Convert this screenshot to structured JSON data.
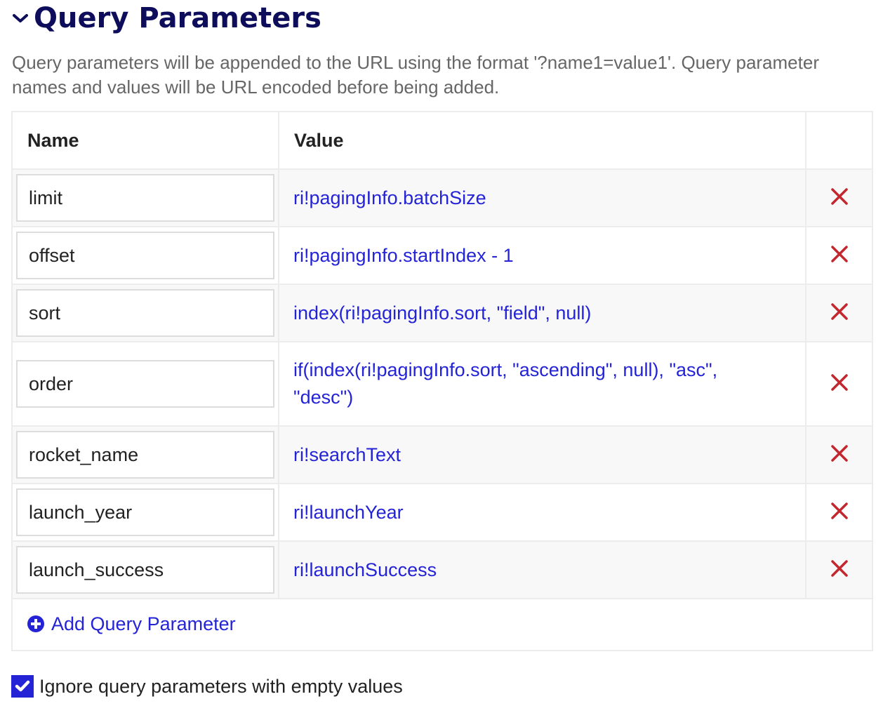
{
  "section": {
    "title": "Query Parameters",
    "collapse_icon": "chevron-down-icon",
    "description": "Query parameters will be appended to the URL using the format '?name1=value1'. Query parameter names and values will be URL encoded before being added."
  },
  "table": {
    "columns": [
      "Name",
      "Value",
      ""
    ],
    "rows": [
      {
        "name": "limit",
        "value": "ri!pagingInfo.batchSize"
      },
      {
        "name": "offset",
        "value": "ri!pagingInfo.startIndex - 1"
      },
      {
        "name": "sort",
        "value": "index(ri!pagingInfo.sort, \"field\", null)"
      },
      {
        "name": "order",
        "value": "if(index(ri!pagingInfo.sort, \"ascending\", null), \"asc\", \"desc\")"
      },
      {
        "name": "rocket_name",
        "value": "ri!searchText"
      },
      {
        "name": "launch_year",
        "value": "ri!launchYear"
      },
      {
        "name": "launch_success",
        "value": "ri!launchSuccess"
      }
    ],
    "delete_icon": "close-icon",
    "add_label": "Add Query Parameter",
    "add_icon": "plus-circle-icon"
  },
  "options": {
    "ignore_empty_label": "Ignore query parameters with empty values",
    "ignore_empty_checked": true
  },
  "colors": {
    "title": "#0d0d5c",
    "link": "#2424d6",
    "delete": "#c4262e",
    "checkbox": "#2424d6",
    "description": "#666666",
    "row_alt": "#f8f8f8",
    "border": "#ececec"
  }
}
